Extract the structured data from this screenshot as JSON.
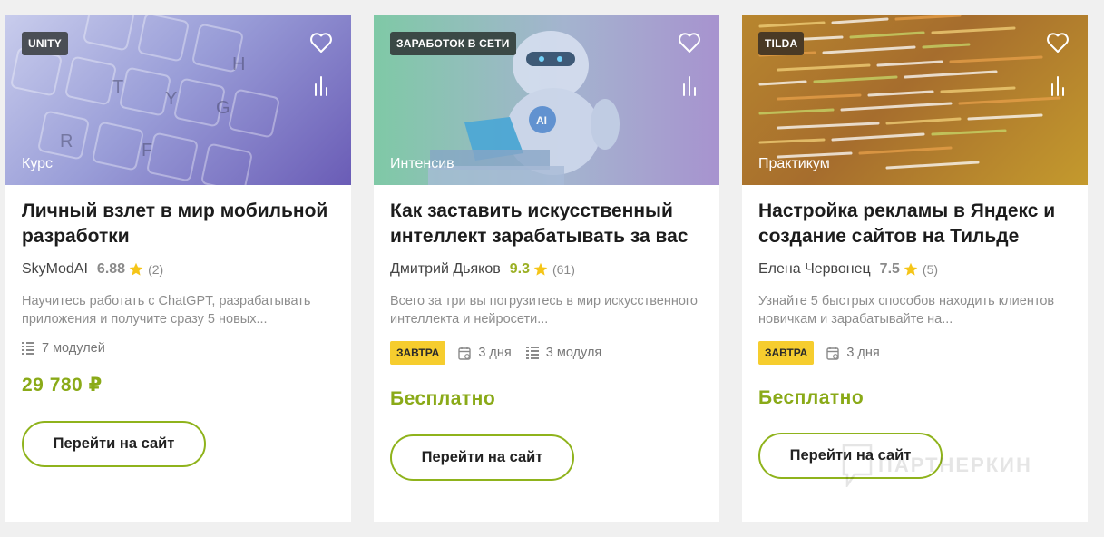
{
  "cards": [
    {
      "category_badge": "UNITY",
      "format": "Курс",
      "title": "Личный взлет в мир мобильной разработки",
      "author": "SkyModAI",
      "rating": "6.88",
      "reviews": "(2)",
      "description": "Научитесь работать с ChatGPT, разрабатывать приложения и получите сразу 5 новых...",
      "modules": "7 модулей",
      "price": "29 780 ₽",
      "button_label": "Перейти на сайт",
      "icons": [
        "heart-icon",
        "compare-icon",
        "star-icon",
        "modules-icon"
      ]
    },
    {
      "category_badge": "ЗАРАБОТОК В СЕТИ",
      "format": "Интенсив",
      "title": "Как заставить искусственный интеллект зарабатывать за вас",
      "author": "Дмитрий Дьяков",
      "rating": "9.3",
      "reviews": "(61)",
      "description": "Всего за три вы погрузитесь в мир искусственного интеллекта и нейросети...",
      "start_tag": "ЗАВТРА",
      "duration": "3 дня",
      "modules": "3 модуля",
      "price": "Бесплатно",
      "button_label": "Перейти на сайт",
      "icons": [
        "heart-icon",
        "compare-icon",
        "star-icon",
        "calendar-icon",
        "modules-icon"
      ]
    },
    {
      "category_badge": "TILDA",
      "format": "Практикум",
      "title": "Настройка рекламы в Яндекс и создание сайтов на Тильде",
      "author": "Елена Червонец",
      "rating": "7.5",
      "reviews": "(5)",
      "description": "Узнайте 5 быстрых способов находить клиентов новичкам и зарабатывайте на...",
      "start_tag": "ЗАВТРА",
      "duration": "3 дня",
      "price": "Бесплатно",
      "button_label": "Перейти на сайт",
      "icons": [
        "heart-icon",
        "compare-icon",
        "star-icon",
        "calendar-icon"
      ]
    }
  ],
  "watermark": "ПАРТНЕРКИН",
  "colors": {
    "accent_green": "#8fb31c",
    "price_green": "#8aaa18",
    "rating_green": "#9bb025",
    "tag_yellow": "#f6cd2e",
    "star_yellow": "#f5c518"
  }
}
